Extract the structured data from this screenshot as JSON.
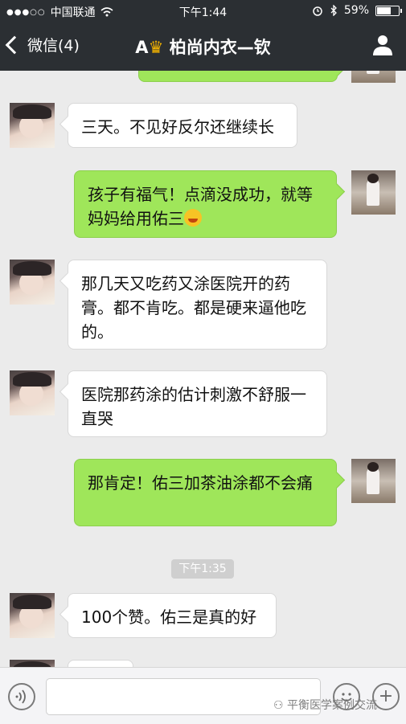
{
  "status_bar": {
    "signal_icon": "signal-dots-icon",
    "carrier": "中国联通",
    "time": "下午1:44",
    "battery_percent": "59%",
    "battery_level": 0.59
  },
  "nav": {
    "back_label": "微信(4)",
    "title_prefix": "A",
    "title_icon": "crown-icon",
    "title": "柏尚内衣—钦"
  },
  "messages": [
    {
      "side": "left",
      "text": "三天。不见好反尔还继续长"
    },
    {
      "side": "right",
      "text": "孩子有福气！点滴没成功，就等妈妈给用佑三",
      "emoji": "laughing-face-emoji"
    },
    {
      "side": "left",
      "text": "那几天又吃药又涂医院开的药膏。都不肯吃。都是硬来逼他吃的。"
    },
    {
      "side": "left",
      "text": "医院那药涂的估计刺激不舒服一直哭"
    },
    {
      "side": "right",
      "text": "那肯定！佑三加茶油涂都不会痛"
    },
    {
      "side": "left",
      "text": "100个赞。佑三是真的好"
    }
  ],
  "timestamp": "下午1:35",
  "input_bar": {
    "voice_icon": "voice-icon",
    "emoji_icon": "emoji-face-icon",
    "plus_icon": "plus-icon",
    "watermark": "平衡医学案例交流"
  },
  "colors": {
    "nav_bg": "#2b2f33",
    "chat_bg": "#ebebeb",
    "bubble_green": "#9fe65a",
    "bubble_white": "#ffffff"
  }
}
